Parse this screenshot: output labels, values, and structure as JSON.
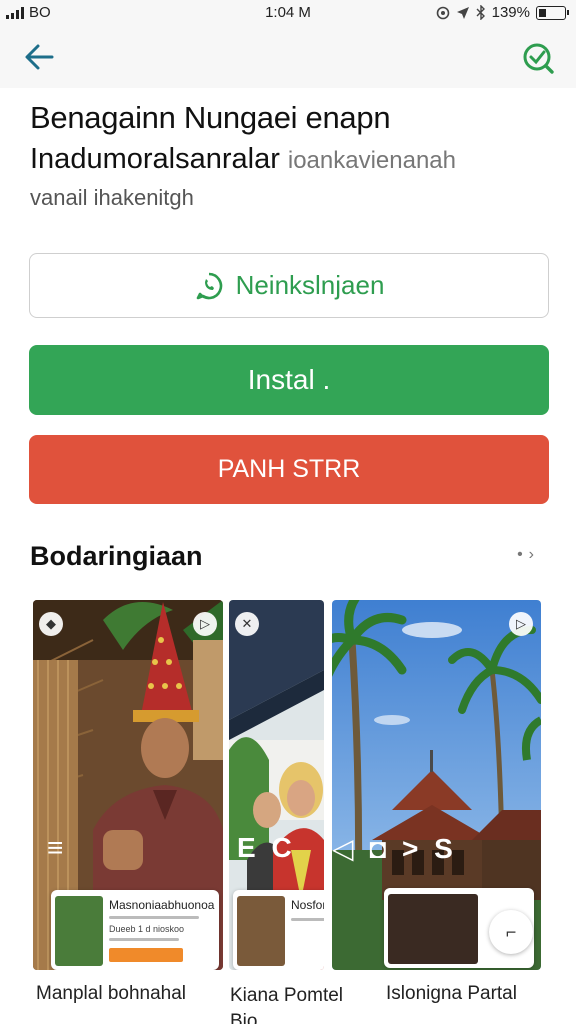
{
  "status_bar": {
    "carrier": "BO",
    "time": "1:04 M",
    "battery_percent": "139%"
  },
  "app_bar": {
    "back_icon": "arrow-left-icon",
    "action_icon": "sync-icon",
    "accent": "#2e9d4f"
  },
  "app": {
    "title": "Benagainn Nungaei enapn",
    "subtitle": "Inadumoralsanralar",
    "subtitle_muted": "ioankavienanah",
    "description": "vanail ihakenitgh"
  },
  "buttons": {
    "outline_label": "Neinkslnjaen",
    "outline_icon": "whatsapp-icon",
    "install_label": "Instal .",
    "red_label": "PANH STRR",
    "colors": {
      "green": "#33a556",
      "red": "#e0523c"
    }
  },
  "screenshots_section": {
    "title": "Bodaringiaan",
    "more_icon": "chevron-right-icon",
    "overlay_text": "E C 4 > S",
    "items": [
      {
        "caption": "Manplal bohnahal",
        "card_title": "Masnoniaabhuonoa",
        "card_sub": "Dueeb 1 d nioskoo"
      },
      {
        "caption": "Kiana Pomtel Bio",
        "card_title": "Nosforiaalara",
        "card_sub": ""
      },
      {
        "caption": "Islonigna Partal",
        "card_title": "",
        "card_sub": ""
      }
    ]
  }
}
